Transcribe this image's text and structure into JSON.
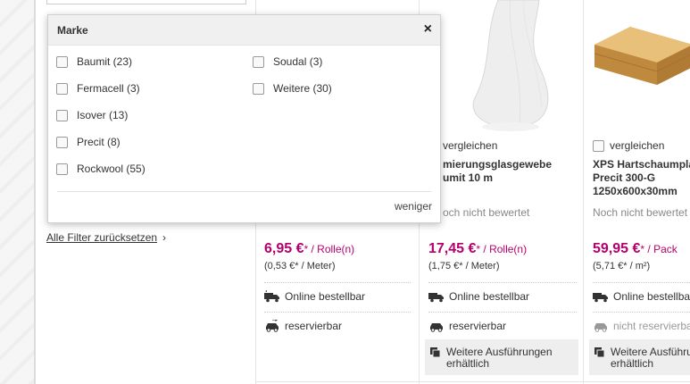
{
  "filter": {
    "title": "Marke",
    "close": "×",
    "options": [
      {
        "label": "Baumit (23)"
      },
      {
        "label": "Fermacell (3)"
      },
      {
        "label": "Isover (13)"
      },
      {
        "label": "Precit (8)"
      },
      {
        "label": "Rockwool (55)"
      },
      {
        "label": "Soudal (3)"
      },
      {
        "label": "Weitere (30)"
      }
    ],
    "less_label": "weniger"
  },
  "reset": {
    "label": "Alle Filter zurücksetzen",
    "chevron": "›"
  },
  "products": [
    {
      "price": "6,95 €",
      "unit": "* / Rolle(n)",
      "base_price": "(0,53 €* / Meter)",
      "online": "Online bestellbar",
      "reserve": "reservierbar"
    },
    {
      "compare": "vergleichen",
      "title_line1": "mierungsglasgewebe",
      "title_line2": "umit 10 m",
      "rating": "och nicht bewertet",
      "price": "17,45 €",
      "unit": "* / Rolle(n)",
      "base_price": "(1,75 €* / Meter)",
      "online": "Online bestellbar",
      "reserve": "reservierbar",
      "variants_line1": "Weitere Ausführungen",
      "variants_line2": "erhältlich"
    },
    {
      "compare": "vergleichen",
      "title_line1": "XPS Hartschaumpla",
      "title_line2": "Precit 300-G",
      "title_line3": "1250x600x30mm",
      "rating": "Noch nicht bewertet",
      "price": "59,95 €",
      "unit": "* / Pack",
      "base_price": "(5,71 €* / m²)",
      "online": "Online bestellbar",
      "reserve": "nicht reservierbar",
      "variants_line1": "Weitere Ausführun",
      "variants_line2": "erhältlich"
    }
  ],
  "colors": {
    "price": "#b5006c",
    "variants_bg": "#eeeeee"
  },
  "icons": {
    "truck": "truck-icon",
    "car": "car-icon",
    "variants": "variants-icon",
    "close": "close-icon"
  }
}
